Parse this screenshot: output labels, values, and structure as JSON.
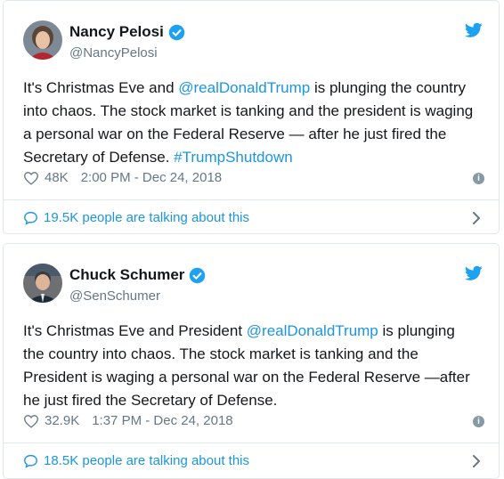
{
  "tweets": [
    {
      "name": "Nancy Pelosi",
      "handle": "@NancyPelosi",
      "text_parts": [
        {
          "t": "It's Christmas Eve and ",
          "link": false
        },
        {
          "t": "@realDonaldTrump",
          "link": true
        },
        {
          "t": " is plunging the country into chaos. The stock market is tanking and the president is waging a personal war on the Federal Reserve — after he just fired the Secretary of Defense. ",
          "link": false
        },
        {
          "t": "#TrumpShutdown",
          "link": true
        }
      ],
      "likes": "48K",
      "timestamp": "2:00 PM - Dec 24, 2018",
      "talking": "19.5K people are talking about this",
      "icons": {
        "verified": "verified-badge-icon",
        "bird": "twitter-bird-icon",
        "heart": "heart-icon",
        "info": "info-icon",
        "bubble": "comment-bubble-icon",
        "chevron": "chevron-right-icon"
      }
    },
    {
      "name": "Chuck Schumer",
      "handle": "@SenSchumer",
      "text_parts": [
        {
          "t": "It's Christmas Eve and President ",
          "link": false
        },
        {
          "t": "@realDonaldTrump",
          "link": true
        },
        {
          "t": " is plunging the country into chaos. The stock market is tanking and the President is waging a personal war on the Federal Reserve —after he just fired the Secretary of Defense.",
          "link": false
        }
      ],
      "likes": "32.9K",
      "timestamp": "1:37 PM - Dec 24, 2018",
      "talking": "18.5K people are talking about this",
      "icons": {
        "verified": "verified-badge-icon",
        "bird": "twitter-bird-icon",
        "heart": "heart-icon",
        "info": "info-icon",
        "bubble": "comment-bubble-icon",
        "chevron": "chevron-right-icon"
      }
    }
  ],
  "colors": {
    "link": "#1b95e0",
    "secondary": "#657786",
    "border": "#e1e8ed",
    "text": "#14171a"
  }
}
